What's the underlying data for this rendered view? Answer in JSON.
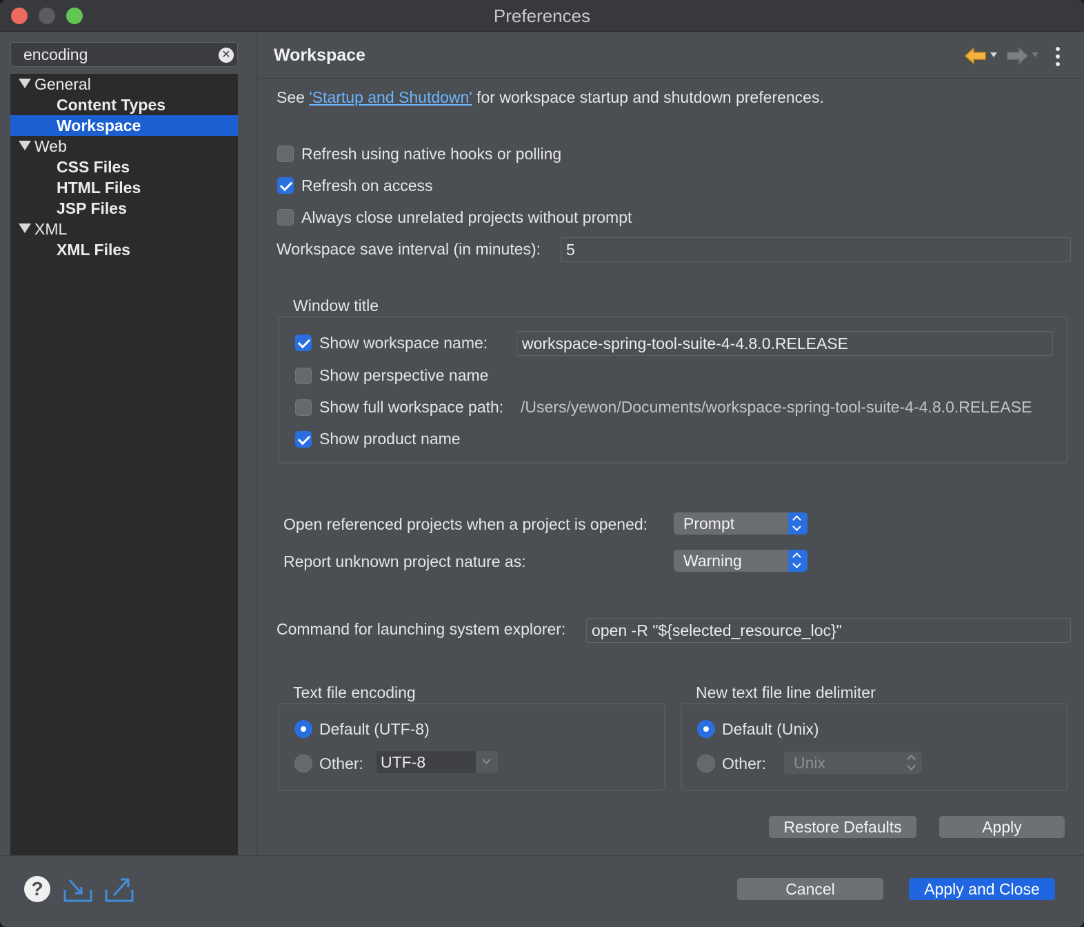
{
  "window": {
    "title": "Preferences"
  },
  "filter": {
    "value": "encoding"
  },
  "tree": [
    {
      "label": "General",
      "level": 0
    },
    {
      "label": "Content Types",
      "level": 1
    },
    {
      "label": "Workspace",
      "level": 1,
      "selected": true
    },
    {
      "label": "Web",
      "level": 0
    },
    {
      "label": "CSS Files",
      "level": 1
    },
    {
      "label": "HTML Files",
      "level": 1
    },
    {
      "label": "JSP Files",
      "level": 1
    },
    {
      "label": "XML",
      "level": 0
    },
    {
      "label": "XML Files",
      "level": 1
    }
  ],
  "page": {
    "title": "Workspace",
    "intro_prefix": "See ",
    "intro_link": "'Startup and Shutdown'",
    "intro_suffix": " for workspace startup and shutdown preferences.",
    "refresh_native": {
      "label": "Refresh using native hooks or polling",
      "checked": false
    },
    "refresh_access": {
      "label": "Refresh on access",
      "checked": true
    },
    "always_close": {
      "label": "Always close unrelated projects without prompt",
      "checked": false
    },
    "save_interval": {
      "label": "Workspace save interval (in minutes):",
      "value": "5"
    },
    "window_title": {
      "legend": "Window title",
      "show_workspace_name": {
        "label": "Show workspace name:",
        "checked": true,
        "value": "workspace-spring-tool-suite-4-4.8.0.RELEASE"
      },
      "show_perspective_name": {
        "label": "Show perspective name",
        "checked": false
      },
      "show_full_path": {
        "label": "Show full workspace path:",
        "checked": false,
        "value": "/Users/yewon/Documents/workspace-spring-tool-suite-4-4.8.0.RELEASE"
      },
      "show_product_name": {
        "label": "Show product name",
        "checked": true
      }
    },
    "open_referenced": {
      "label": "Open referenced projects when a project is opened:",
      "value": "Prompt"
    },
    "report_unknown": {
      "label": "Report unknown project nature as:",
      "value": "Warning"
    },
    "system_explorer": {
      "label": "Command for launching system explorer:",
      "value": "open -R \"${selected_resource_loc}\""
    },
    "encoding": {
      "legend": "Text file encoding",
      "default_label": "Default (UTF-8)",
      "other_label": "Other:",
      "other_value": "UTF-8",
      "selected": "default"
    },
    "delimiter": {
      "legend": "New text file line delimiter",
      "default_label": "Default (Unix)",
      "other_label": "Other:",
      "other_value": "Unix",
      "selected": "default"
    },
    "restore_defaults": "Restore Defaults",
    "apply": "Apply"
  },
  "footer": {
    "cancel": "Cancel",
    "apply_and_close": "Apply and Close",
    "help_glyph": "?"
  },
  "icons": {
    "back": "back-arrow-icon",
    "forward": "forward-arrow-icon",
    "menu": "vertical-ellipsis-icon",
    "help": "help-icon",
    "import": "import-icon",
    "export": "export-icon"
  },
  "colors": {
    "accent": "#1f66e0",
    "selection": "#1b5fd1",
    "link": "#6cb6ff",
    "back_arrow": "#f2b33d"
  }
}
